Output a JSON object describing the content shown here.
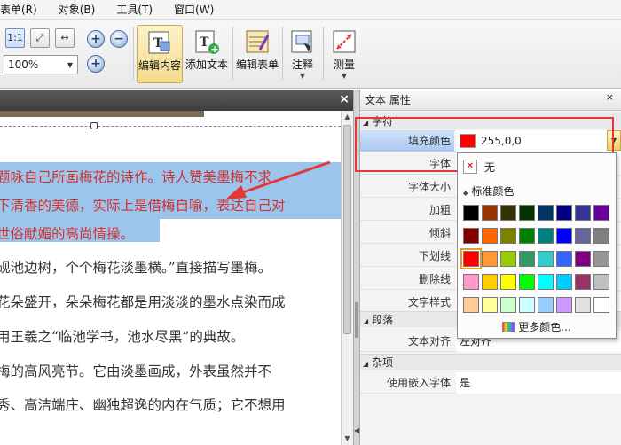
{
  "menubar": {
    "items": [
      "表单(R)",
      "对象(B)",
      "工具(T)",
      "窗口(W)"
    ]
  },
  "toolbar": {
    "zoom_value": "100%",
    "zoom_in_symbol": "+",
    "zoom_out_symbol": "−",
    "buttons": {
      "edit_content": "编辑内容",
      "add_text": "添加文本",
      "edit_form": "编辑表单",
      "annotate": "注释",
      "measure": "测量"
    }
  },
  "document": {
    "close_symbol": "×",
    "highlighted_lines": [
      "题咏自己所画梅花的诗作。诗人赞美墨梅不求",
      "下清香的美德，实际上是借梅自喻，表达自己对",
      "世俗献媚的高尚情操。"
    ],
    "body_lines": [
      "砚池边树，个个梅花淡墨横。”直接描写墨梅。",
      "花朵盛开，朵朵梅花都是用淡淡的墨水点染而成",
      "用王羲之“临池学书，池水尽黑”的典故。",
      "梅的高风亮节。它由淡墨画成，外表虽然并不",
      "秀、高洁端庄、幽独超逸的内在气质；它不想用"
    ],
    "text_color": "#d0312d",
    "highlight_color": "#9cc5ee"
  },
  "panel": {
    "title": "文本 属性",
    "close_symbol": "×",
    "sections": {
      "character": "字符",
      "paragraph": "段落",
      "misc": "杂项"
    },
    "props": {
      "fill_color_label": "填充颜色",
      "fill_color_value": "255,0,0",
      "font_label": "字体",
      "font_size_label": "字体大小",
      "bold_label": "加粗",
      "italic_label": "倾斜",
      "underline_label": "下划线",
      "strikethrough_label": "删除线",
      "text_style_label": "文字样式",
      "text_align_label": "文本对齐",
      "text_align_value": "左对齐",
      "embed_font_label": "使用嵌入字体",
      "embed_font_value": "是"
    },
    "fill_color_hex": "#ff0000"
  },
  "color_picker": {
    "none_label": "无",
    "standard_label": "标准颜色",
    "more_colors_label": "更多颜色...",
    "colors": [
      [
        "#000000",
        "#993300",
        "#333300",
        "#003300",
        "#003366",
        "#000080",
        "#333399",
        "#660099"
      ],
      [
        "#800000",
        "#ff6600",
        "#808000",
        "#008000",
        "#008080",
        "#0000ff",
        "#666699",
        "#808080"
      ],
      [
        "#ff0000",
        "#ff9933",
        "#99cc00",
        "#339966",
        "#33cccc",
        "#3366ff",
        "#800080",
        "#969696"
      ],
      [
        "#ff99cc",
        "#ffcc00",
        "#ffff00",
        "#00ff00",
        "#00ffff",
        "#00ccff",
        "#993366",
        "#c0c0c0"
      ],
      [
        "#ffcc99",
        "#ffff99",
        "#ccffcc",
        "#ccffff",
        "#99ccff",
        "#cc99ff",
        "#e0e0e0",
        "#ffffff"
      ]
    ],
    "selected_color": "#ff0000"
  }
}
